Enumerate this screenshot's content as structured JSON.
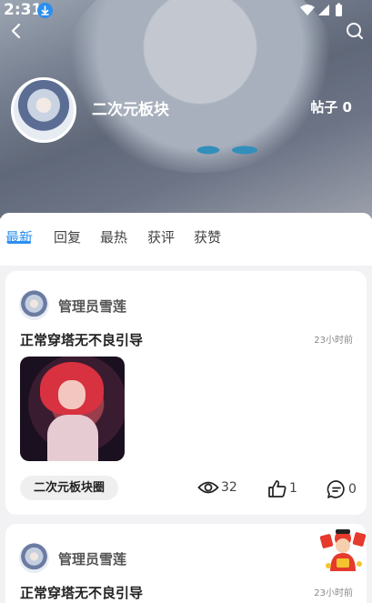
{
  "status_bar": {
    "time": "2:31"
  },
  "board": {
    "name": "二次元板块",
    "post_count": "帖子 0"
  },
  "tabs": [
    {
      "label": "最新",
      "active": true
    },
    {
      "label": "回复",
      "active": false
    },
    {
      "label": "最热",
      "active": false
    },
    {
      "label": "获评",
      "active": false
    },
    {
      "label": "获赞",
      "active": false
    }
  ],
  "posts": [
    {
      "author": "管理员雪莲",
      "title": "正常穿塔无不良引导",
      "time": "23小时前",
      "tag": "二次元板块圈",
      "views": "32",
      "likes": "1",
      "comments": "0"
    },
    {
      "author": "管理员雪莲",
      "title": "正常穿塔无不良引导",
      "time": "23小时前"
    }
  ],
  "colors": {
    "accent": "#2a8ff1"
  }
}
